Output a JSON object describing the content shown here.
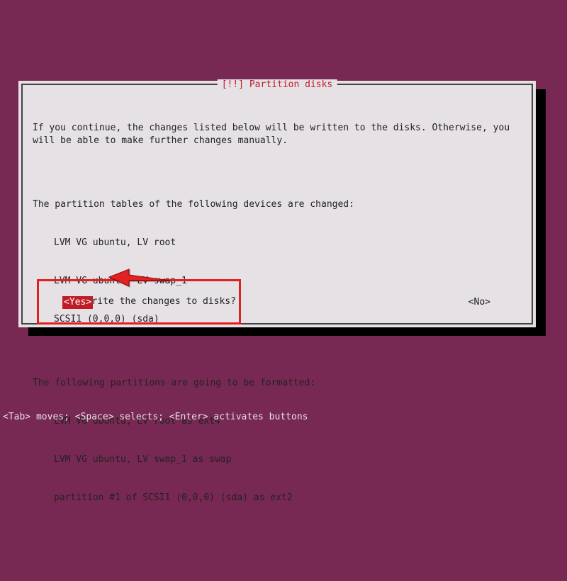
{
  "dialog": {
    "title": "[!!] Partition disks",
    "intro": "If you continue, the changes listed below will be written to the disks. Otherwise, you will be able to make further changes manually.",
    "tables_heading": "The partition tables of the following devices are changed:",
    "tables": [
      "LVM VG ubuntu, LV root",
      "LVM VG ubuntu, LV swap_1",
      "SCSI1 (0,0,0) (sda)"
    ],
    "format_heading": "The following partitions are going to be formatted:",
    "formats": [
      "LVM VG ubuntu, LV root as ext4",
      "LVM VG ubuntu, LV swap_1 as swap",
      "partition #1 of SCSI1 (0,0,0) (sda) as ext2"
    ],
    "question": "Write the changes to disks?",
    "yes_label": "<Yes>",
    "no_label": "<No>"
  },
  "footer": "<Tab> moves; <Space> selects; <Enter> activates buttons",
  "colors": {
    "background": "#772953",
    "dialog_bg": "#e6e1e5",
    "accent_red": "#c01c28",
    "annotation_red": "#e02020"
  }
}
